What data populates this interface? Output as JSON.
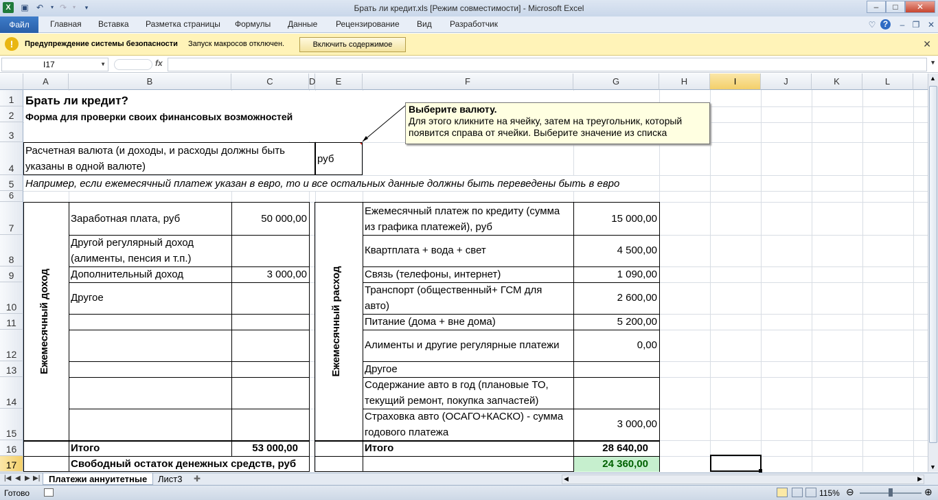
{
  "window": {
    "title": "Брать ли кредит.xls  [Режим совместимости]  -  Microsoft Excel",
    "quick_access": [
      "excel-icon",
      "save-icon",
      "undo-icon",
      "redo-icon",
      "customize-icon"
    ]
  },
  "ribbon": {
    "file_tab": "Файл",
    "tabs": [
      "Главная",
      "Вставка",
      "Разметка страницы",
      "Формулы",
      "Данные",
      "Рецензирование",
      "Вид",
      "Разработчик"
    ]
  },
  "security_bar": {
    "label": "Предупреждение системы безопасности",
    "message": "Запуск макросов отключен.",
    "button": "Включить содержимое"
  },
  "formula_bar": {
    "name_box": "I17",
    "fx": "fx",
    "formula": ""
  },
  "columns": [
    "A",
    "B",
    "C",
    "D",
    "E",
    "F",
    "G",
    "H",
    "I",
    "J",
    "K",
    "L"
  ],
  "rows": [
    "1",
    "2",
    "3",
    "4",
    "5",
    "6",
    "7",
    "8",
    "9",
    "10",
    "11",
    "12",
    "13",
    "14",
    "15",
    "16",
    "17"
  ],
  "cells": {
    "title": "Брать ли кредит?",
    "subtitle": "Форма для проверки своих финансовых возможностей",
    "currency_label": "Расчетная валюта (и доходы, и расходы должны быть указаны в одной валюте)",
    "currency_value": "руб",
    "example_note": "Например, если ежемесячный платеж  указан в евро, то и все остальных данные должны быть переведены быть в евро",
    "income_section": "Ежемесячный доход",
    "expense_section": "Ежемесячный расход",
    "income": [
      {
        "label": "Заработная плата, руб",
        "value": "50 000,00"
      },
      {
        "label": "Другой регулярный доход (алименты, пенсия и т.п.)",
        "value": ""
      },
      {
        "label": "Дополнительный доход",
        "value": "3 000,00"
      },
      {
        "label": "Другое",
        "value": ""
      }
    ],
    "income_total_label": "Итого",
    "income_total": "53 000,00",
    "expenses": [
      {
        "label": "Ежемесячный платеж по кредиту (сумма из графика платежей), руб",
        "value": "15 000,00"
      },
      {
        "label": "Квартплата + вода + свет",
        "value": "4 500,00"
      },
      {
        "label": "Связь (телефоны, интернет)",
        "value": "1 090,00"
      },
      {
        "label": "Транспорт (общественный+ ГСМ для авто)",
        "value": "2 600,00"
      },
      {
        "label": "Питание (дома + вне дома)",
        "value": "5 200,00"
      },
      {
        "label": "Алименты и другие регулярные платежи",
        "value": "0,00"
      },
      {
        "label": "Другое",
        "value": ""
      },
      {
        "label": "Содержание  авто в год (плановые ТО, текущий ремонт, покупка запчастей)",
        "value": ""
      },
      {
        "label": "Страховка авто (ОСАГО+КАСКО) - сумма годового платежа",
        "value": "3 000,00"
      }
    ],
    "expense_total_label": "Итого",
    "expense_total": "28 640,00",
    "free_balance_label": "Свободный остаток денежных средств, руб",
    "free_balance": "24 360,00"
  },
  "comment": {
    "title": "Выберите валюту.",
    "text": "Для этого кликните на ячейку, затем на треугольник, который появится справа от ячейки. Выберите значение из списка"
  },
  "sheet_tabs": [
    "Платежи аннуитетные",
    "Лист3"
  ],
  "status": {
    "ready": "Готово",
    "zoom": "115%"
  },
  "colors": {
    "green_fill": "#c6efce",
    "green_text": "#006100",
    "selection": "#f3cf6a"
  }
}
